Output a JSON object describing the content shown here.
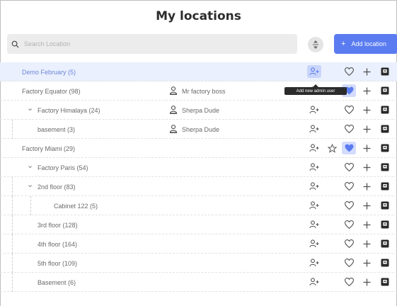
{
  "header": {
    "title": "My locations"
  },
  "search": {
    "placeholder": "Search Location"
  },
  "toolbar": {
    "add_label": "Add location",
    "add_plus": "+"
  },
  "tooltip": {
    "text": "Add new admin user"
  },
  "colors": {
    "accent": "#5a7cf0",
    "highlight_bg": "#eaf0fd",
    "star": "#f5b400",
    "heart_filled": "#5a7cf0",
    "box": "#2a2a2a"
  },
  "rows": [
    {
      "name": "Demo February (5)",
      "admin": "",
      "highlight": true,
      "ua_active": true,
      "star": "none",
      "heart": "outline"
    },
    {
      "name": "Factory Equator (98)",
      "admin": "Mr factory boss",
      "star": "filled",
      "heart": "filled"
    },
    {
      "name": "Factory Himalaya (24)",
      "admin": "Sherpa Dude",
      "expanded": true,
      "star": "none",
      "heart": "outline"
    },
    {
      "name": "basement (3)",
      "admin": "Sherpa Dude",
      "star": "none",
      "heart": "outline"
    },
    {
      "name": "Factory Miami (29)",
      "admin": "",
      "star": "outline",
      "heart": "filled"
    },
    {
      "name": "Factory Paris (54)",
      "admin": "",
      "expanded": true,
      "star": "none",
      "heart": "outline"
    },
    {
      "name": "2nd floor (83)",
      "admin": "",
      "expanded": true,
      "star": "none",
      "heart": "outline"
    },
    {
      "name": "Cabinet 122 (5)",
      "admin": "",
      "star": "none",
      "heart": "outline"
    },
    {
      "name": "3rd floor (128)",
      "admin": "",
      "star": "none",
      "heart": "outline"
    },
    {
      "name": "4th floor (164)",
      "admin": "",
      "star": "none",
      "heart": "outline"
    },
    {
      "name": "5th floor (109)",
      "admin": "",
      "star": "none",
      "heart": "outline"
    },
    {
      "name": "Basement (6)",
      "admin": "",
      "star": "none",
      "heart": "outline"
    }
  ]
}
